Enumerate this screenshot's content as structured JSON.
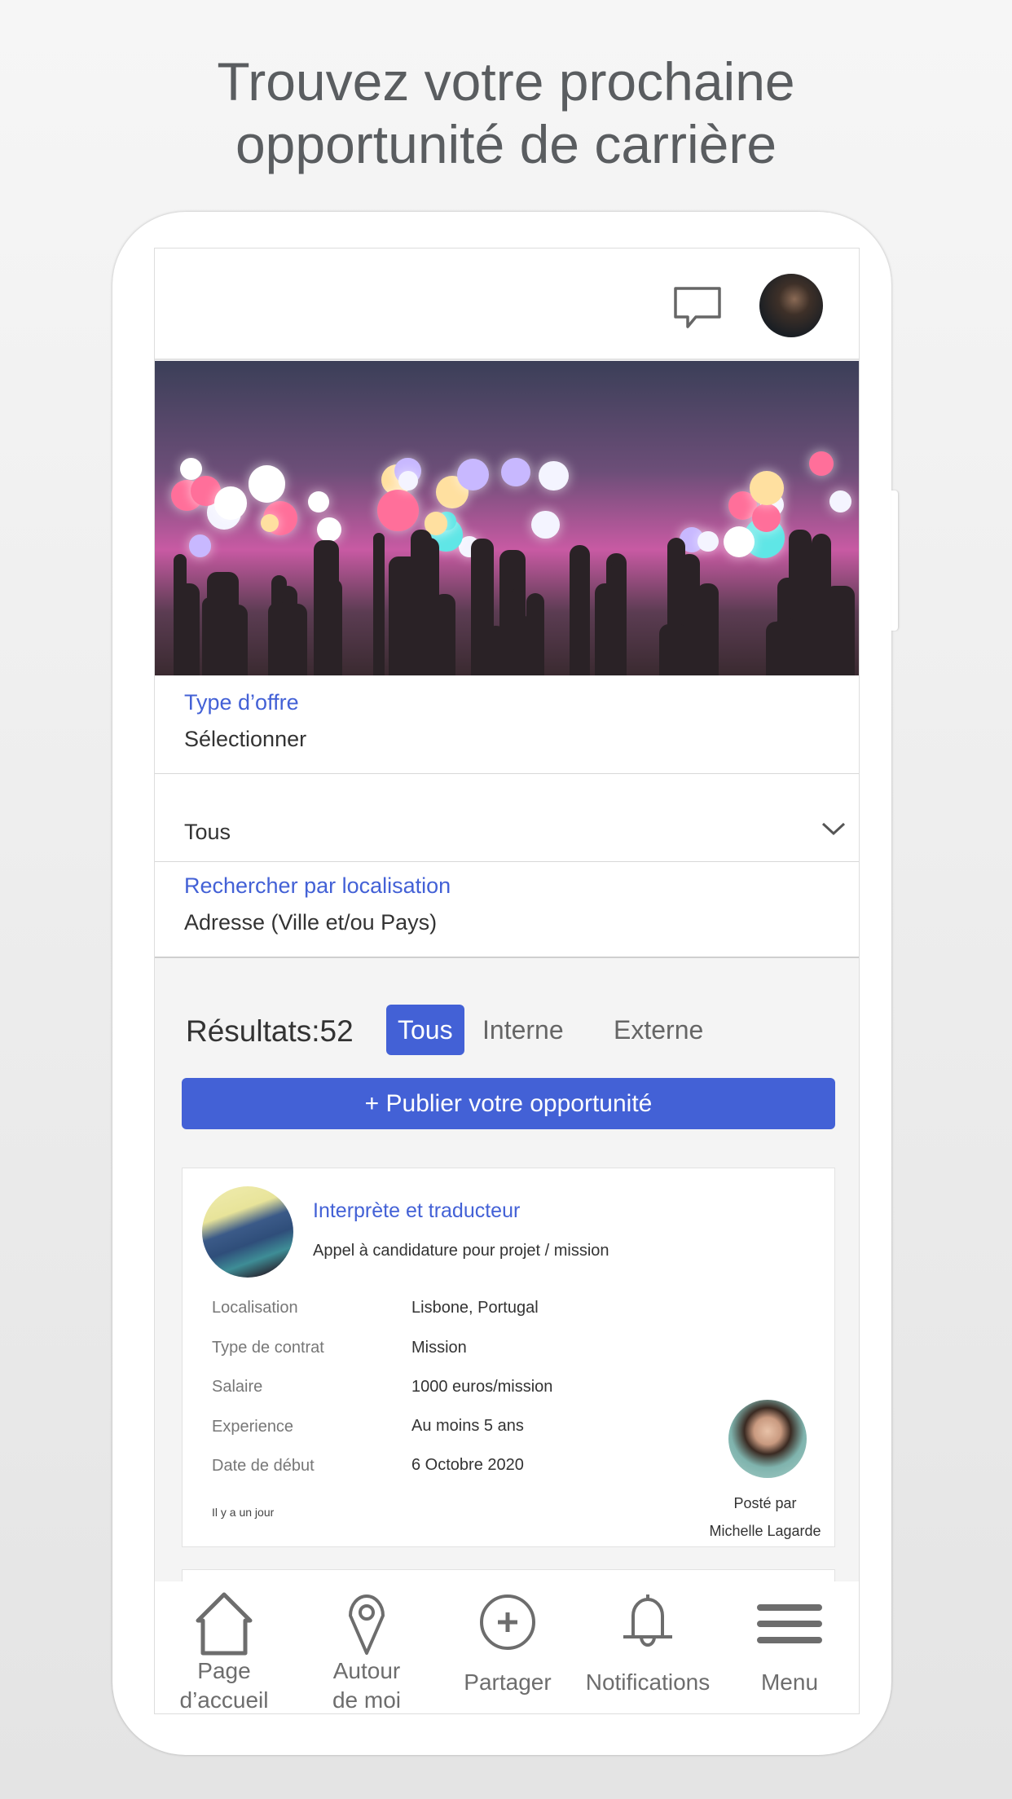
{
  "headline": {
    "line1": "Trouvez votre prochaine",
    "line2": "opportunité de carrière"
  },
  "header": {
    "icons": [
      "chat-icon",
      "user-avatar"
    ]
  },
  "form": {
    "offer_type": {
      "label": "Type d’offre",
      "value": "Sélectionner"
    },
    "category": {
      "value": "Tous"
    },
    "location": {
      "label": "Rechercher par localisation",
      "placeholder": "Adresse (Ville et/ou Pays)"
    }
  },
  "results": {
    "label": "Résultats:52",
    "tabs": [
      {
        "label": "Tous",
        "active": true
      },
      {
        "label": "Interne",
        "active": false
      },
      {
        "label": "Externe",
        "active": false
      }
    ]
  },
  "publish": {
    "icon": "+",
    "label": "Publier votre opportunité"
  },
  "accent": "#4361d6",
  "card": {
    "title": "Interprète et traducteur",
    "subtitle": "Appel à candidature pour projet / mission",
    "rows": [
      {
        "label": "Localisation",
        "value": "Lisbone, Portugal"
      },
      {
        "label": "Type de contrat",
        "value": "Mission"
      },
      {
        "label": "Salaire",
        "value": "1000 euros/mission"
      },
      {
        "label": "Experience",
        "value": "Au moins 5 ans"
      },
      {
        "label": "Date de début",
        "value": "6 Octobre 2020"
      }
    ],
    "ago": "Il y a un jour",
    "posted_by": "Posté par",
    "poster": "Michelle Lagarde"
  },
  "nav": [
    {
      "icon": "home-icon",
      "line1": "Page",
      "line2": "d’accueil"
    },
    {
      "icon": "location-pin-icon",
      "line1": "Autour",
      "line2": "de moi"
    },
    {
      "icon": "plus-circle-icon",
      "line1": "Partager"
    },
    {
      "icon": "bell-icon",
      "line1": "Notifications"
    },
    {
      "icon": "menu-icon",
      "line1": "Menu"
    }
  ]
}
